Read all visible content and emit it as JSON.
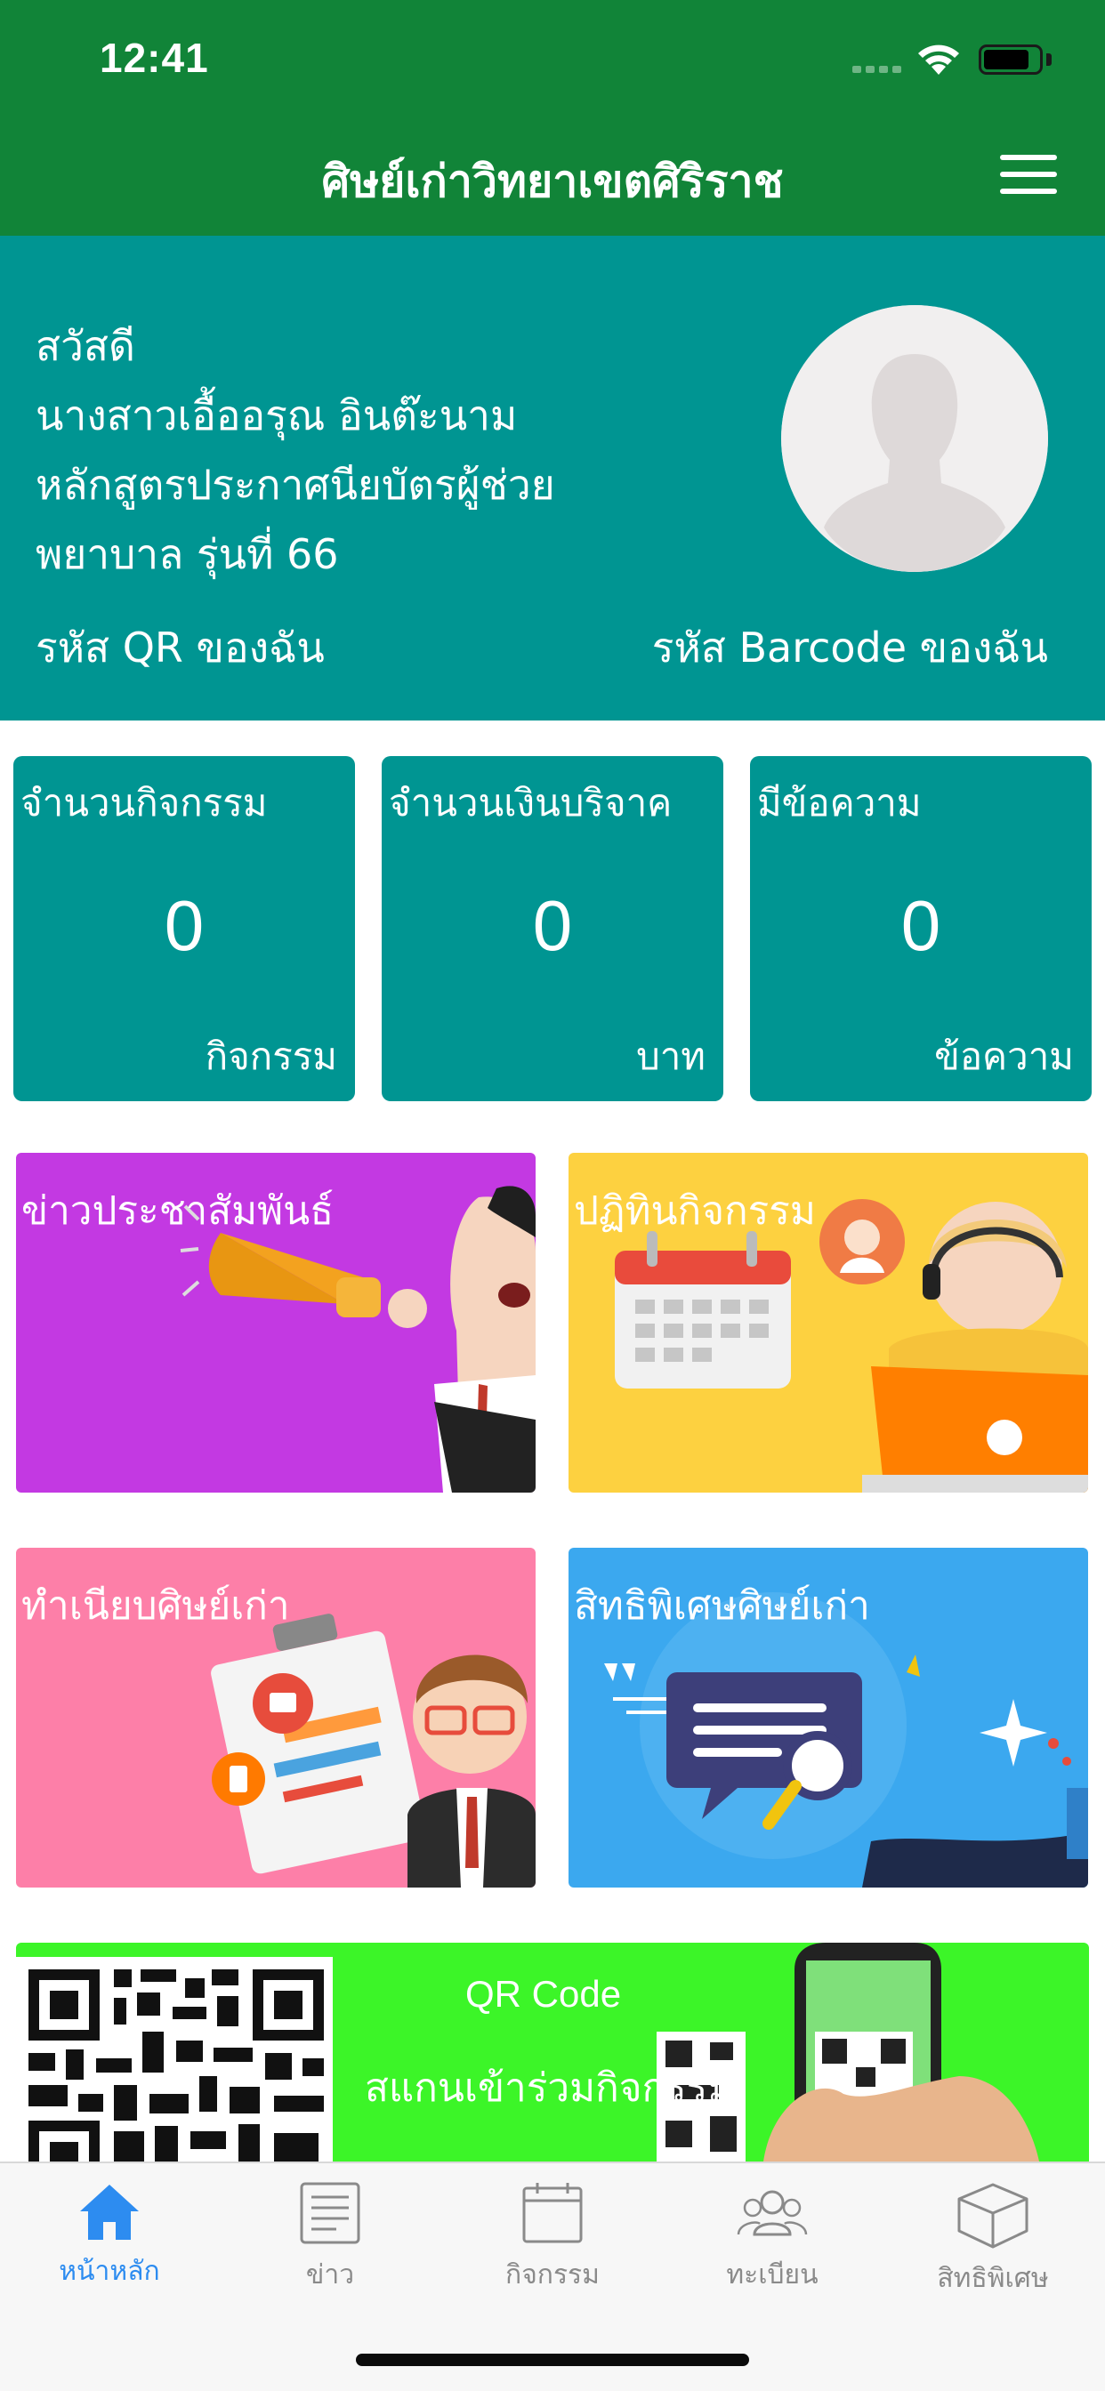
{
  "status_bar": {
    "time": "12:41"
  },
  "nav": {
    "title": "ศิษย์เก่าวิทยาเขตศิริราช",
    "menu_icon": "hamburger-menu-icon"
  },
  "profile": {
    "greeting": "สวัสดี",
    "name": "นางสาวเอื้ออรุณ อินต๊ะนาม",
    "program_line1": "หลักสูตรประกาศนียบัตรผู้ช่วย",
    "program_line2": "พยาบาล รุ่นที่ 66",
    "qr_link": "รหัส QR ของฉัน",
    "barcode_link": "รหัส Barcode ของฉัน",
    "avatar_icon": "user-avatar-placeholder"
  },
  "stats": [
    {
      "title": "จำนวนกิจกรรม",
      "value": "0",
      "unit": "กิจกรรม"
    },
    {
      "title": "จำนวนเงินบริจาค",
      "value": "0",
      "unit": "บาท"
    },
    {
      "title": "มีข้อความ",
      "value": "0",
      "unit": "ข้อความ"
    }
  ],
  "tiles": [
    {
      "label": "ข่าวประชาสัมพันธ์",
      "color": "#c339e2"
    },
    {
      "label": "ปฏิทินกิจกรรม",
      "color": "#fdd140"
    },
    {
      "label": "ทำเนียบศิษย์เก่า",
      "color": "#fd7fa8"
    },
    {
      "label": "สิทธิพิเศษศิษย์เก่า",
      "color": "#3ba8ef"
    }
  ],
  "qr_banner": {
    "title": "QR Code",
    "subtitle": "สแกนเข้าร่วมกิจกรรม",
    "color": "#3cf528"
  },
  "tabbar": {
    "items": [
      {
        "label": "หน้าหลัก",
        "icon": "home-icon",
        "active": true
      },
      {
        "label": "ข่าว",
        "icon": "news-icon",
        "active": false
      },
      {
        "label": "กิจกรรม",
        "icon": "calendar-icon",
        "active": false
      },
      {
        "label": "ทะเบียน",
        "icon": "people-icon",
        "active": false
      },
      {
        "label": "สิทธิพิเศษ",
        "icon": "box-icon",
        "active": false
      }
    ],
    "active_color": "#2d8cf0",
    "inactive_color": "#8a8a8a"
  },
  "colors": {
    "primary_green": "#118438",
    "teal": "#009592"
  }
}
